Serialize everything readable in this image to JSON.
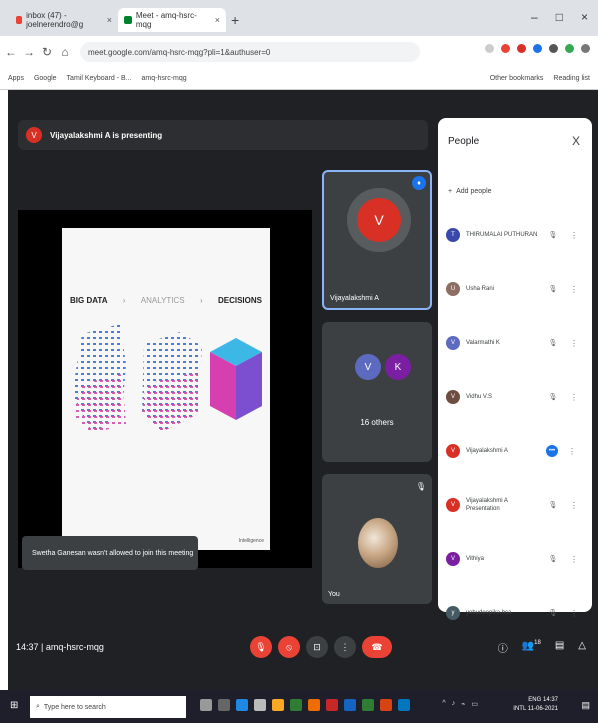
{
  "tabs": [
    {
      "label": "inbox (47) - joelnerendro@g",
      "active": false
    },
    {
      "label": "Meet - amq-hsrc-mqg",
      "active": true
    }
  ],
  "new_tab_symbol": "+",
  "window_controls": [
    "–",
    "□",
    "×"
  ],
  "nav": {
    "back": "←",
    "forward": "→",
    "reload": "↻",
    "home": "⌂"
  },
  "url": "meet.google.com/amq-hsrc-mqg?pli=1&authuser=0",
  "bookmarks": {
    "left": [
      "Apps",
      "Google",
      "Tamil Keyboard - B...",
      "amq-hsrc-mqg"
    ],
    "right": [
      "Other bookmarks",
      "Reading list"
    ]
  },
  "presenting": {
    "avatar_letter": "V",
    "text": "Vijayalakshmi A is presenting"
  },
  "slide": {
    "titles": [
      "BIG DATA",
      "ANALYTICS",
      "DECISIONS"
    ],
    "chevron": "›",
    "tag": "Intelligence"
  },
  "tiles": {
    "presenter": {
      "name": "Vijayalakshmi A",
      "avatar_letter": "V",
      "speaking_icon": "♦"
    },
    "others": {
      "letters": [
        "V",
        "K"
      ],
      "label": "16 others"
    },
    "you": {
      "label": "You",
      "mic_icon": "🎙"
    }
  },
  "toast": "Swetha Ganesan wasn't allowed to join this meeting",
  "people_panel": {
    "title": "People",
    "close": "X",
    "add_people": "Add people",
    "people": [
      {
        "name": "THIRUMALAI PUTHURAN",
        "color": "#3949ab",
        "letter": "T",
        "mic": "🎙",
        "active": false
      },
      {
        "name": "Usha Rani",
        "color": "#8d6e63",
        "letter": "U",
        "mic": "🎙",
        "active": false
      },
      {
        "name": "Valarmathi K",
        "color": "#5c6bc0",
        "letter": "V",
        "mic": "🎙",
        "active": false
      },
      {
        "name": "Vidhu V.S",
        "color": "#6d4c41",
        "letter": "V",
        "mic": "🎙",
        "active": false
      },
      {
        "name": "Vijayalakshmi A",
        "color": "#d93025",
        "letter": "V",
        "mic": "",
        "active": true
      },
      {
        "name": "Vijayalakshmi A Presentation",
        "color": "#d93025",
        "letter": "V",
        "mic": "🎙",
        "active": false
      },
      {
        "name": "Vithiya",
        "color": "#7b1fa2",
        "letter": "V",
        "mic": "🎙",
        "active": false
      },
      {
        "name": "yehudeepika.bca",
        "color": "#455a64",
        "letter": "y",
        "mic": "🎙",
        "active": false
      }
    ]
  },
  "bottom": {
    "time": "14:37",
    "separator": "|",
    "meeting_code": "amq-hsrc-mqg",
    "controls": [
      "🎙",
      "⦸",
      "⊡",
      "⋮",
      "☎"
    ],
    "right": [
      "ⓘ",
      "👥",
      "▤",
      "△"
    ],
    "participant_count": "18"
  },
  "taskbar": {
    "start": "⊞",
    "search_placeholder": "Type here to search",
    "tray_lang": "ENG",
    "tray_region": "INTL",
    "tray_time": "14:37",
    "tray_date": "11-06-2021",
    "tray_icons": [
      "^",
      "♪",
      "⌁",
      "▭"
    ],
    "notification_icon": "▤"
  },
  "colors": {
    "meet_bg": "#202124",
    "tile_bg": "#3c4043",
    "presenter_red": "#d93025",
    "accent_blue": "#1a73e8"
  }
}
